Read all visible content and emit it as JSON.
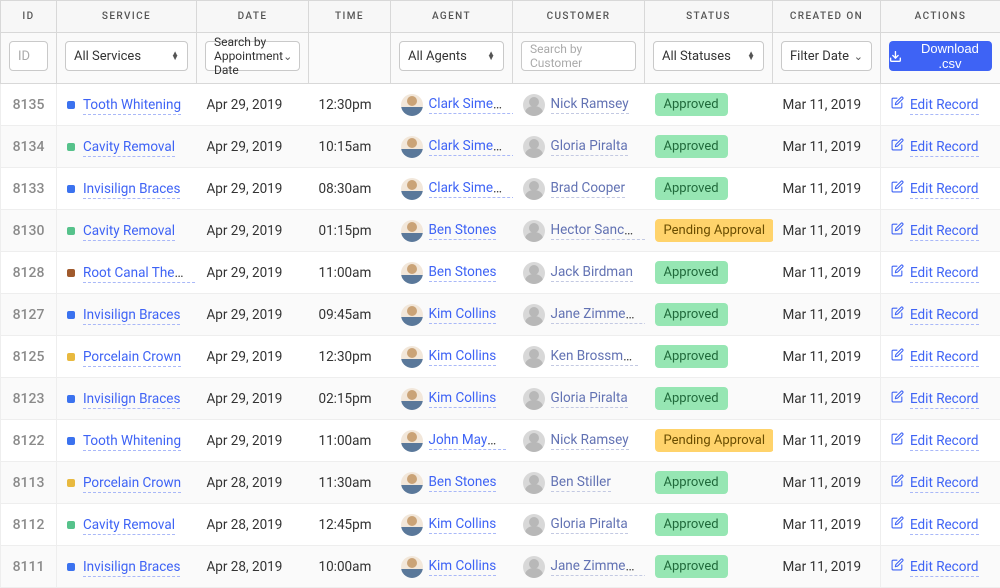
{
  "headers": {
    "id": "ID",
    "service": "SERVICE",
    "date": "DATE",
    "time": "TIME",
    "agent": "AGENT",
    "customer": "CUSTOMER",
    "status": "STATUS",
    "created": "CREATED ON",
    "actions": "ACTIONS"
  },
  "filters": {
    "id_placeholder": "ID",
    "service_sel": "All Services",
    "date_sel": "Search by Appointment Date",
    "agent_sel": "All Agents",
    "customer_placeholder": "Search by Customer",
    "status_sel": "All Statuses",
    "created_sel": "Filter Date",
    "download_label": "Download .csv"
  },
  "colors": {
    "blue": "#3b72ef",
    "green": "#56c28b",
    "brown": "#a05a2c",
    "yellow": "#e8b93f"
  },
  "statuses": {
    "approved": "Approved",
    "pending": "Pending Approval"
  },
  "action_label": "Edit Record",
  "rows": [
    {
      "id": "8135",
      "service": "Tooth Whitening",
      "service_dot": "blue",
      "date": "Apr 29, 2019",
      "time": "12:30pm",
      "agent": "Clark Simeone",
      "customer": "Nick Ramsey",
      "status": "approved",
      "created": "Mar 11, 2019"
    },
    {
      "id": "8134",
      "service": "Cavity Removal",
      "service_dot": "green",
      "date": "Apr 29, 2019",
      "time": "10:15am",
      "agent": "Clark Simeone",
      "customer": "Gloria Piralta",
      "status": "approved",
      "created": "Mar 11, 2019"
    },
    {
      "id": "8133",
      "service": "Invisilign Braces",
      "service_dot": "blue",
      "date": "Apr 29, 2019",
      "time": "08:30am",
      "agent": "Clark Simeone",
      "customer": "Brad Cooper",
      "status": "approved",
      "created": "Mar 11, 2019"
    },
    {
      "id": "8130",
      "service": "Cavity Removal",
      "service_dot": "green",
      "date": "Apr 29, 2019",
      "time": "01:15pm",
      "agent": "Ben Stones",
      "customer": "Hector Sanchez",
      "status": "pending",
      "created": "Mar 11, 2019"
    },
    {
      "id": "8128",
      "service": "Root Canal Therapy",
      "service_dot": "brown",
      "date": "Apr 29, 2019",
      "time": "11:00am",
      "agent": "Ben Stones",
      "customer": "Jack Birdman",
      "status": "approved",
      "created": "Mar 11, 2019"
    },
    {
      "id": "8127",
      "service": "Invisilign Braces",
      "service_dot": "blue",
      "date": "Apr 29, 2019",
      "time": "09:45am",
      "agent": "Kim Collins",
      "customer": "Jane Zimmerman",
      "status": "approved",
      "created": "Mar 11, 2019"
    },
    {
      "id": "8125",
      "service": "Porcelain Crown",
      "service_dot": "yellow",
      "date": "Apr 29, 2019",
      "time": "12:30pm",
      "agent": "Kim Collins",
      "customer": "Ken Brossman",
      "status": "approved",
      "created": "Mar 11, 2019"
    },
    {
      "id": "8123",
      "service": "Invisilign Braces",
      "service_dot": "blue",
      "date": "Apr 29, 2019",
      "time": "02:15pm",
      "agent": "Kim Collins",
      "customer": "Gloria Piralta",
      "status": "approved",
      "created": "Mar 11, 2019"
    },
    {
      "id": "8122",
      "service": "Tooth Whitening",
      "service_dot": "blue",
      "date": "Apr 29, 2019",
      "time": "11:00am",
      "agent": "John Mayers",
      "customer": "Nick Ramsey",
      "status": "pending",
      "created": "Mar 11, 2019"
    },
    {
      "id": "8113",
      "service": "Porcelain Crown",
      "service_dot": "yellow",
      "date": "Apr 28, 2019",
      "time": "11:30am",
      "agent": "Ben Stones",
      "customer": "Ben Stiller",
      "status": "approved",
      "created": "Mar 11, 2019"
    },
    {
      "id": "8112",
      "service": "Cavity Removal",
      "service_dot": "green",
      "date": "Apr 28, 2019",
      "time": "12:45pm",
      "agent": "Kim Collins",
      "customer": "Gloria Piralta",
      "status": "approved",
      "created": "Mar 11, 2019"
    },
    {
      "id": "8111",
      "service": "Invisilign Braces",
      "service_dot": "blue",
      "date": "Apr 28, 2019",
      "time": "10:00am",
      "agent": "Kim Collins",
      "customer": "Jane Zimmerman",
      "status": "approved",
      "created": "Mar 11, 2019"
    }
  ]
}
